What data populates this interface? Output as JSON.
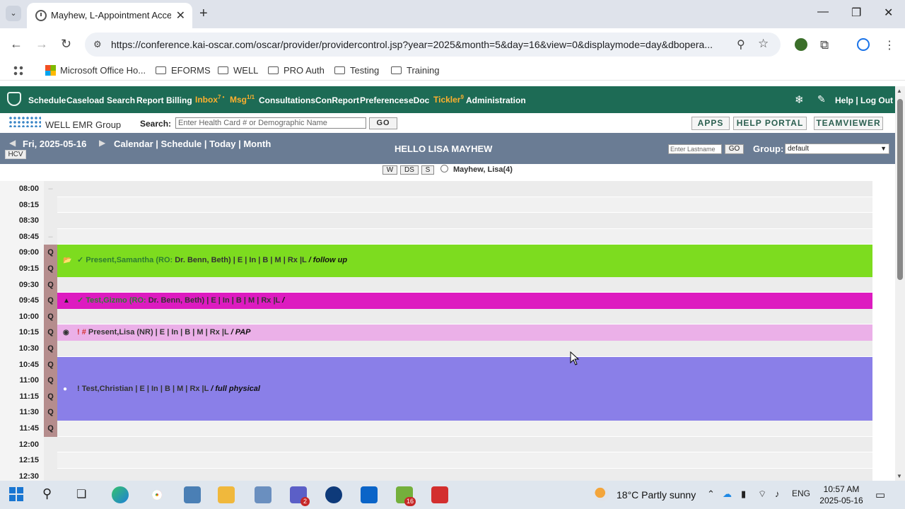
{
  "browser": {
    "tab_title": "Mayhew, L-Appointment Acce",
    "url": "https://conference.kai-oscar.com/oscar/provider/providercontrol.jsp?year=2025&month=5&day=16&view=0&displaymode=day&dbopera...",
    "bookmarks": [
      "Microsoft Office Ho...",
      "EFORMS",
      "WELL",
      "PRO Auth",
      "Testing",
      "Training"
    ]
  },
  "nav": {
    "items": [
      {
        "label": "Schedule"
      },
      {
        "label": "Caseload"
      },
      {
        "label": "Search"
      },
      {
        "label": "Report"
      },
      {
        "label": "Billing"
      },
      {
        "label": "Inbox",
        "sup": "7 •"
      },
      {
        "label": "Msg",
        "sup": "1/1"
      },
      {
        "label": "Consultations"
      },
      {
        "label": "ConReport"
      },
      {
        "label": "Preferences"
      },
      {
        "label": "eDoc"
      },
      {
        "label": "Tickler",
        "sup": "9"
      },
      {
        "label": "Administration"
      }
    ],
    "help_logout": "Help | Log Out"
  },
  "searchbar": {
    "brand": "WELL EMR Group",
    "label": "Search:",
    "placeholder": "Enter Health Card # or Demographic Name",
    "go": "GO",
    "apps": "APPS",
    "help_portal": "HELP PORTAL",
    "teamviewer": "TEAMVIEWER"
  },
  "datebar": {
    "date": "Fri, 2025-05-16",
    "calnav": "Calendar | Schedule | Today | Month",
    "hcv": "HCV",
    "hello": "HELLO LISA MAYHEW",
    "lastname_placeholder": "Enter Lastname",
    "go": "GO",
    "group_label": "Group:",
    "group_value": "default"
  },
  "provider": {
    "views": [
      "W",
      "DS",
      "S"
    ],
    "name": "Mayhew, Lisa(4)"
  },
  "schedule": {
    "times": [
      "08:00",
      "08:15",
      "08:30",
      "08:45",
      "09:00",
      "09:15",
      "09:30",
      "09:45",
      "10:00",
      "10:15",
      "10:30",
      "10:45",
      "11:00",
      "11:15",
      "11:30",
      "11:45",
      "12:00",
      "12:15",
      "12:30"
    ],
    "q_label": "Q",
    "appointments": [
      {
        "icon": "folder-icon",
        "status": "✓",
        "name": "Present,Samantha",
        "ro_label": "RO:",
        "ro": "Dr. Benn, Beth)",
        "links": "| E | In | B | M | Rx |L",
        "note": "/ follow up",
        "color": "#7ddc1f"
      },
      {
        "icon": "person-icon",
        "status": "✓",
        "name": "Test,Gizmo",
        "ro_label": "RO:",
        "ro": "Dr. Benn, Beth)",
        "links": "| E | In | B | M | Rx |L",
        "note": "/",
        "color": "#dd1bc0"
      },
      {
        "icon": "eye-icon",
        "status": "! #",
        "name": "Present,Lisa",
        "ro_label": "",
        "ro": "(NR)",
        "links": "| E | In | B | M | Rx |L",
        "note": "/ PAP",
        "color": "#ebb0e8"
      },
      {
        "icon": "badge-icon",
        "status": "!",
        "name": "Test,Christian",
        "ro_label": "",
        "ro": "",
        "links": "| E | In | B | M | Rx |L",
        "note": "/ full physical",
        "color": "#8a7fe8"
      }
    ]
  },
  "taskbar": {
    "weather": "18°C  Partly sunny",
    "lang": "ENG",
    "time": "10:57 AM",
    "date": "2025-05-16",
    "teams_badge": "2",
    "cal_badge": "16"
  }
}
